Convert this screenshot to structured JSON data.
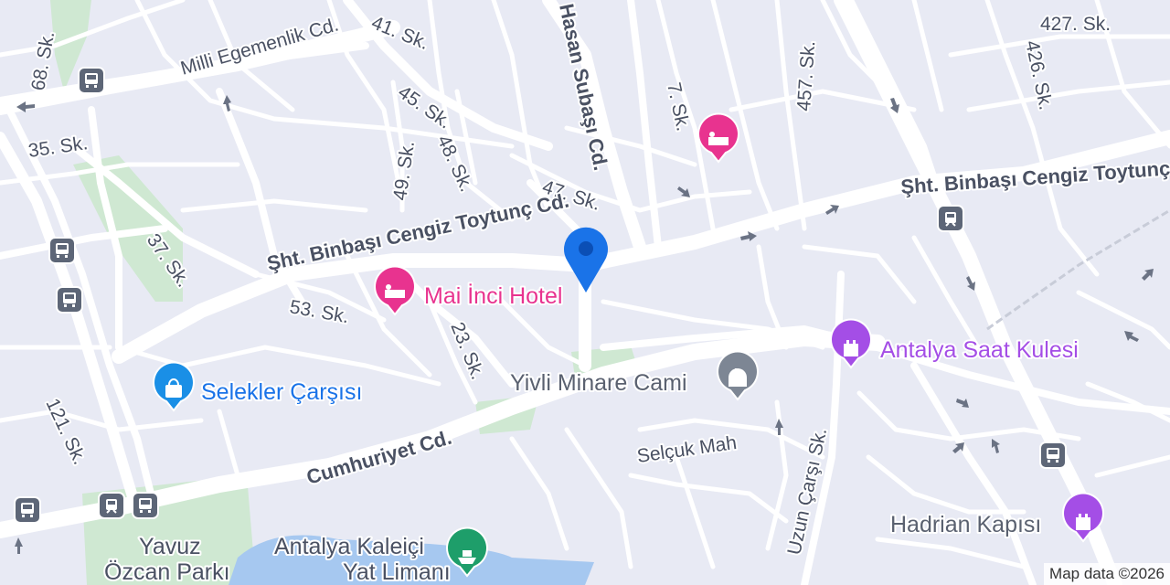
{
  "colors": {
    "hotel": "#e8338f",
    "landmark": "#a44ee6",
    "shopping": "#1a8fe6",
    "mosque": "#7d8694",
    "marina": "#1e9e6a",
    "transit": "#5d6677",
    "location_pin": "#1a73e8",
    "park": "#cfe8d2",
    "water": "#a6c8f0"
  },
  "streets": {
    "milli_egemenlik": "Milli Egemenlik Cd.",
    "s41": "41. Sk.",
    "s68": "68. Sk.",
    "hasan_subasi": "Hasan Subaşı Cd.",
    "s7": "7. Sk.",
    "s457": "457. Sk.",
    "s427": "427. Sk.",
    "s426": "426. Sk.",
    "s35": "35. Sk.",
    "s45": "45. Sk.",
    "s48": "48. Sk.",
    "s49": "49. Sk.",
    "s47": "47. Sk.",
    "sht_left": "Şht. Binbaşı Cengiz Toytunç Cd.",
    "sht_right": "Şht. Binbaşı Cengiz Toytunç",
    "s37": "37. Sk.",
    "s53": "53. Sk.",
    "s23": "23. Sk.",
    "cumhuriyet": "Cumhuriyet Cd.",
    "s121": "121. Sk.",
    "uzun_carsi": "Uzun Çarşı Sk.",
    "selcuk_mah": "Selçuk Mah"
  },
  "places": {
    "mai_inci": "Mai İnci Hotel",
    "selekler": "Selekler Çarşısı",
    "yivli": "Yivli Minare Cami",
    "saat_kulesi": "Antalya Saat Kulesi",
    "hadrian": "Hadrian Kapısı",
    "kaleici_1": "Antalya Kaleiçi",
    "kaleici_2": "Yat Limanı",
    "yavuz_1": "Yavuz",
    "yavuz_2": "Özcan Parkı"
  },
  "attribution": "Map data ©2026"
}
